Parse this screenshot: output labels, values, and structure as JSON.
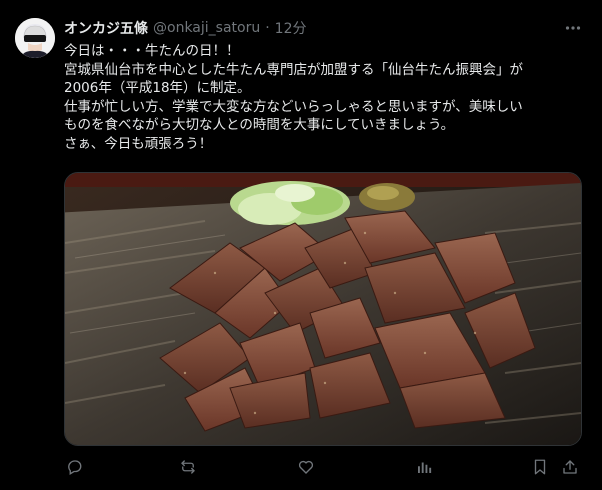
{
  "tweet": {
    "author_name": "オンカジ五條",
    "handle": "@onkaji_satoru",
    "separator": "·",
    "time": "12分",
    "lines": [
      "今日は・・・牛たんの日！！",
      "宮城県仙台市を中心とした牛たん専門店が加盟する「仙台牛たん振興会」が",
      "2006年（平成18年）に制定。",
      "仕事が忙しい方、学業で大変な方などいらっしゃると思いますが、美味しい",
      "ものを食べながら大切な人との時間を大事にしていきましょう。",
      "さぁ、今日も頑張ろう！"
    ]
  },
  "icons": {
    "more": "more-icon",
    "reply": "reply-icon",
    "retweet": "retweet-icon",
    "like": "heart-icon",
    "views": "views-icon",
    "bookmark": "bookmark-icon",
    "share": "share-icon"
  },
  "colors": {
    "background": "#000000",
    "text": "#e7e9ea",
    "muted": "#71767b"
  }
}
